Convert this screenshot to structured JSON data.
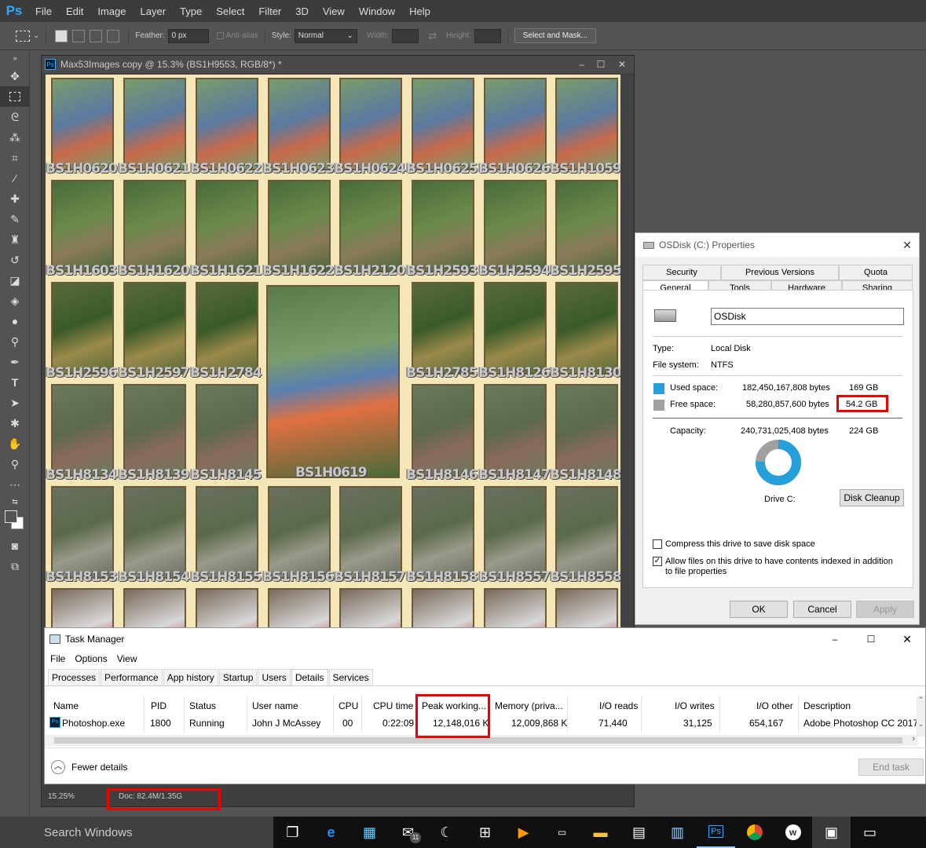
{
  "photoshop": {
    "logo": "Ps",
    "menu": [
      "File",
      "Edit",
      "Image",
      "Layer",
      "Type",
      "Select",
      "Filter",
      "3D",
      "View",
      "Window",
      "Help"
    ],
    "options": {
      "feather_label": "Feather:",
      "feather_value": "0 px",
      "antialias_label": "Anti-alias",
      "style_label": "Style:",
      "style_value": "Normal",
      "width_label": "Width:",
      "height_label": "Height:",
      "select_mask_button": "Select and Mask..."
    },
    "document": {
      "title": "Max53Images copy @ 15.3% (BS1H9553, RGB/8*) *",
      "zoom": "15.25%",
      "doc_info": "Doc: 82.4M/1.35G",
      "thumbnail_labels": [
        [
          "BS1H0620",
          "BS1H0621",
          "BS1H0622",
          "BS1H0623",
          "BS1H0624",
          "BS1H0625",
          "BS1H0626",
          "BS1H1059"
        ],
        [
          "BS1H1603",
          "BS1H1620",
          "BS1H1621",
          "BS1H1622",
          "BS1H2120",
          "BS1H2593",
          "BS1H2594",
          "BS1H2595"
        ],
        [
          "BS1H2596",
          "BS1H2597",
          "BS1H2784",
          "BS1H2785",
          "BS1H8126",
          "BS1H8130"
        ],
        [
          "BS1H8134",
          "BS1H8139",
          "BS1H8145",
          "BS1H0619",
          "BS1H8146",
          "BS1H8147",
          "BS1H8148"
        ],
        [
          "BS1H8153",
          "BS1H8154",
          "BS1H8155",
          "BS1H8156",
          "BS1H8157",
          "BS1H8158",
          "BS1H8557",
          "BS1H8558"
        ]
      ]
    }
  },
  "disk_props": {
    "title": "OSDisk (C:) Properties",
    "tabs_row1": [
      "Security",
      "Previous Versions",
      "Quota"
    ],
    "tabs_row2": [
      "General",
      "Tools",
      "Hardware",
      "Sharing"
    ],
    "name_value": "OSDisk",
    "type_label": "Type:",
    "type_value": "Local Disk",
    "fs_label": "File system:",
    "fs_value": "NTFS",
    "used_label": "Used space:",
    "used_bytes": "182,450,167,808 bytes",
    "used_gb": "169 GB",
    "free_label": "Free space:",
    "free_bytes": "58,280,857,600 bytes",
    "free_gb": "54.2 GB",
    "capacity_label": "Capacity:",
    "capacity_bytes": "240,731,025,408 bytes",
    "capacity_gb": "224 GB",
    "used_fraction": 0.758,
    "used_color": "#26a0da",
    "free_color": "#a0a0a0",
    "drive_label": "Drive C:",
    "cleanup_button": "Disk Cleanup",
    "compress_label": "Compress this drive to save disk space",
    "compress_checked": false,
    "index_label": "Allow files on this drive to have contents indexed in addition to file properties",
    "index_checked": true,
    "ok": "OK",
    "cancel": "Cancel",
    "apply": "Apply"
  },
  "task_manager": {
    "title": "Task Manager",
    "menu": [
      "File",
      "Options",
      "View"
    ],
    "tabs": [
      "Processes",
      "Performance",
      "App history",
      "Startup",
      "Users",
      "Details",
      "Services"
    ],
    "active_tab": "Details",
    "columns": [
      "Name",
      "PID",
      "Status",
      "User name",
      "CPU",
      "CPU time",
      "Peak working...",
      "Memory (priva...",
      "I/O reads",
      "I/O writes",
      "I/O other",
      "Description"
    ],
    "rows": [
      [
        "Photoshop.exe",
        "1800",
        "Running",
        "John J McAssey",
        "00",
        "0:22:09",
        "12,148,016 K",
        "12,009,868 K",
        "71,440",
        "31,125",
        "654,167",
        "Adobe Photoshop CC 2017"
      ]
    ],
    "fewer_details": "Fewer details",
    "end_task": "End task"
  },
  "taskbar": {
    "search_placeholder": "Search Windows",
    "mail_badge": "11"
  }
}
